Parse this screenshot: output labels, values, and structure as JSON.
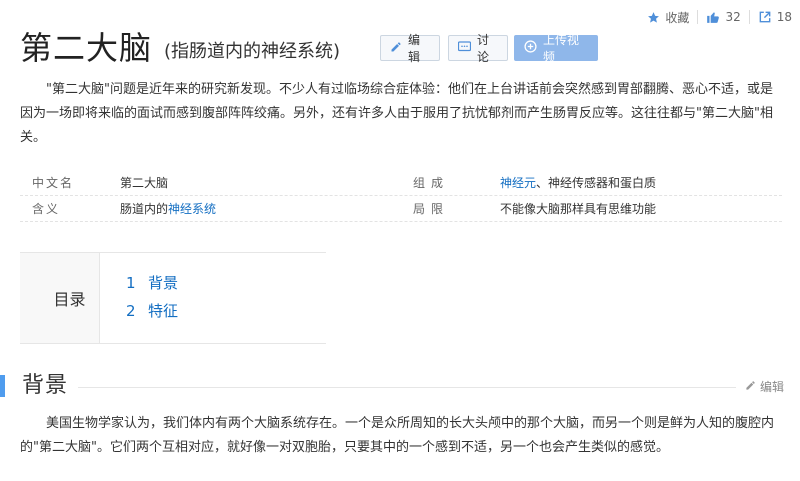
{
  "top_actions": {
    "favorite_label": "收藏",
    "like_count": "32",
    "share_count": "18"
  },
  "header": {
    "title": "第二大脑",
    "subtitle": "(指肠道内的神经系统)",
    "edit_label": "编辑",
    "discuss_label": "讨论",
    "upload_label": "上传视频"
  },
  "summary": {
    "text": "\"第二大脑\"问题是近年来的研究新发现。不少人有过临场综合症体验：他们在上台讲话前会突然感到胃部翻腾、恶心不适，或是因为一场即将来临的面试而感到腹部阵阵绞痛。另外，还有许多人由于服用了抗忧郁剂而产生肠胃反应等。这往往都与\"第二大脑\"相关。"
  },
  "info": {
    "row1": {
      "k1": "中文名",
      "v1": "第二大脑",
      "k2": "组成",
      "v2_link": "神经元",
      "v2_rest": "、神经传感器和蛋白质"
    },
    "row2": {
      "k1": "含义",
      "v1_pre": "肠道内的",
      "v1_link": "神经系统",
      "k2": "局限",
      "v2": "不能像大脑那样具有思维功能"
    }
  },
  "toc": {
    "label": "目录",
    "items": [
      {
        "num": "1",
        "label": "背景"
      },
      {
        "num": "2",
        "label": "特征"
      }
    ]
  },
  "section": {
    "title": "背景",
    "edit_label": "编辑",
    "text": "美国生物学家认为，我们体内有两个大脑系统存在。一个是众所周知的长大头颅中的那个大脑，而另一个则是鲜为人知的腹腔内的\"第二大脑\"。它们两个互相对应，就好像一对双胞胎，只要其中的一个感到不适，另一个也会产生类似的感觉。"
  },
  "colors": {
    "link": "#136ec2",
    "accent_bar": "#4f9cee",
    "upload_button": "#8fb7ea"
  }
}
